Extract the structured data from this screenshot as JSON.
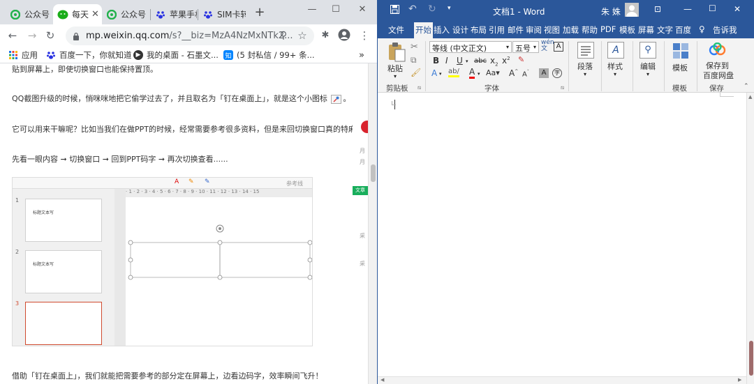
{
  "browser": {
    "tabs": [
      {
        "title": "公众号",
        "active": false
      },
      {
        "title": "每天",
        "active": true
      },
      {
        "title": "公众号",
        "active": false
      },
      {
        "title": "苹果手机",
        "active": false
      },
      {
        "title": "SIM卡转",
        "active": false
      }
    ],
    "new_tab": "+",
    "url_host": "mp.weixin.qq.com",
    "url_path": "/s?__biz=MzA4NzMxNTk2...",
    "bookmarks": [
      {
        "label": "应用",
        "color": "#1a73e8"
      },
      {
        "label": "百度一下，你就知道",
        "color": "#2932e1"
      },
      {
        "label": "我的桌面 - 石墨文...",
        "color": "#333333"
      },
      {
        "label": "(5 封私信 / 99+ 条...",
        "color": "#0084ff",
        "icon_text": "知"
      }
    ],
    "bookmarks_more": "»"
  },
  "article": {
    "p0": "贴到屏幕上，即使切换窗口也能保持置顶。",
    "p1": "QQ截图升级的时候，悄咪咪地把它偷学过去了，并且取名为「钉在桌面上」，就是这个小图标",
    "p1_end": "。",
    "p2": "它可以用来干嘛呢？比如当我们在做PPT的时候，经常需要参考很多资料，但是来回切换窗口真的特麻烦！",
    "p3": "先看一眼内容 ➞ 切换窗口 ➞ 回到PPT码字 ➞ 再次切换查看......",
    "p4": "借助「钉在桌面上」，我们就能把需要参考的部分定在屏幕上，边看边码字，效率瞬间飞升！",
    "side_texts": [
      "月",
      "月",
      "文章",
      "采",
      "采"
    ]
  },
  "ppt_image": {
    "toolbar_text": "参考线",
    "slides": [
      {
        "num": "1",
        "text": "标题文本写"
      },
      {
        "num": "2",
        "text": "标题文本写"
      },
      {
        "num": "3",
        "text": ""
      }
    ],
    "ruler": "· 1 · 2 · 3 · 4 · 5 · 6 · 7 · 8 · 9 · 10 · 11 · 12 · 13 · 14 · 15"
  },
  "word": {
    "title": "文档1 - Word",
    "user": "朱 姝",
    "tabs": [
      "文件",
      "开始",
      "插入",
      "设计",
      "布局",
      "引用",
      "邮件",
      "审阅",
      "视图",
      "加载",
      "帮助",
      "PDF",
      "模板",
      "屏幕",
      "文字",
      "百度",
      "告诉我"
    ],
    "active_tab": "开始",
    "clipboard": {
      "paste": "粘贴",
      "group": "剪贴板"
    },
    "font": {
      "name": "等线 (中文正文)",
      "size": "五号",
      "group": "字体"
    },
    "paragraph": {
      "label": "段落"
    },
    "styles": {
      "label": "样式"
    },
    "editing": {
      "label": "编辑"
    },
    "template": {
      "label": "模板",
      "group": "模板"
    },
    "save": {
      "label1": "保存到",
      "label2": "百度网盘",
      "group": "保存"
    },
    "colors": {
      "brand": "#2b579a",
      "ribbon": "#f3f3f3"
    }
  }
}
